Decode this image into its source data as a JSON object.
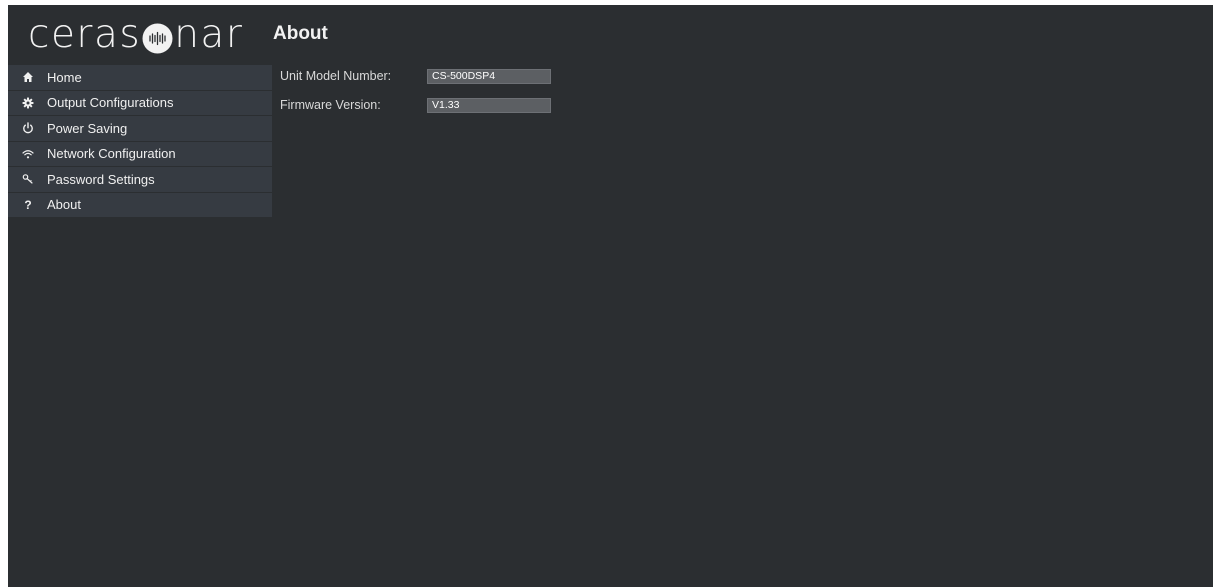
{
  "brand": {
    "logo_text_before": "ceras",
    "logo_text_after": "nar"
  },
  "page": {
    "title": "About"
  },
  "sidebar": {
    "items": [
      {
        "label": "Home",
        "icon": "home-icon"
      },
      {
        "label": "Output Configurations",
        "icon": "gear-icon"
      },
      {
        "label": "Power Saving",
        "icon": "power-icon"
      },
      {
        "label": "Network Configuration",
        "icon": "wifi-icon"
      },
      {
        "label": "Password Settings",
        "icon": "key-icon"
      },
      {
        "label": "About",
        "icon": "question-icon",
        "icon_glyph": "?"
      }
    ]
  },
  "about": {
    "model_label": "Unit Model Number:",
    "model_value": "CS-500DSP4",
    "firmware_label": "Firmware Version:",
    "firmware_value": "V1.33"
  },
  "colors": {
    "background": "#2b2e31",
    "sidebar_item": "#363b42",
    "field_bg": "#5c5f63",
    "text": "#f0f0f0"
  }
}
